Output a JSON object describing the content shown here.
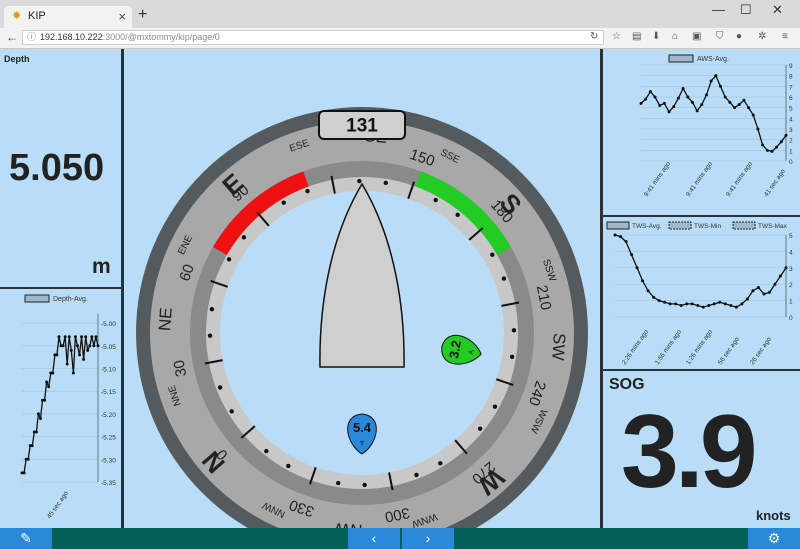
{
  "browser": {
    "tab_title": "KIP",
    "tab_icon": "sun-favicon-icon",
    "new_tab": "+",
    "url_host": "192.168.10.222",
    "url_rest": ":3000/@mxtommy/kip/page/0",
    "win_min": "—",
    "win_max": "☐",
    "win_close": "✕"
  },
  "depth": {
    "title": "Depth",
    "value": "5.050",
    "unit": "m"
  },
  "depth_chart": {
    "type": "line",
    "legend": "Depth-Avg.",
    "yticks": [
      "-5.00",
      "-5.05",
      "-5.10",
      "-5.15",
      "-5.20",
      "-5.25",
      "-5.30",
      "-5.35"
    ],
    "ylim": [
      -5.35,
      -4.98
    ],
    "xtick": "45 sec ago",
    "values": [
      -5.33,
      -5.33,
      -5.3,
      -5.3,
      -5.27,
      -5.27,
      -5.24,
      -5.24,
      -5.2,
      -5.21,
      -5.17,
      -5.17,
      -5.13,
      -5.14,
      -5.11,
      -5.11,
      -5.07,
      -5.07,
      -5.03,
      -5.05,
      -5.05,
      -5.03,
      -5.09,
      -5.03,
      -5.06,
      -5.11,
      -5.03,
      -5.05,
      -5.07,
      -5.03,
      -5.08,
      -5.03,
      -5.06,
      -5.05,
      -5.03,
      -5.05,
      -5.03,
      -5.05
    ]
  },
  "compass": {
    "heading": "131",
    "cardinals": [
      "N",
      "E",
      "S",
      "W"
    ],
    "intercardinals": [
      "NE",
      "SE",
      "SW",
      "NW"
    ],
    "minor": [
      "NNE",
      "ENE",
      "ESE",
      "SSE",
      "SSW",
      "WSW",
      "WNW",
      "NNW"
    ],
    "degree_labels": [
      "0",
      "30",
      "60",
      "90",
      "150",
      "180",
      "210",
      "240",
      "270",
      "300",
      "330"
    ],
    "true_wind": {
      "speed": "5.4",
      "marker": "T",
      "angle_deg": 180,
      "color": "#2a88d8"
    },
    "apparent_wind": {
      "speed": "3.2",
      "marker": "A",
      "angle_deg": 100,
      "color": "#22cc22"
    },
    "port_zone_color": "#ee1111",
    "starboard_zone_color": "#22cc22"
  },
  "aws_chart": {
    "type": "line",
    "legend": "AWS-Avg.",
    "yticks": [
      "9",
      "8",
      "7",
      "6",
      "5",
      "4",
      "3",
      "2",
      "1",
      "0"
    ],
    "ylim": [
      0,
      9
    ],
    "xticks": [
      "9:41 mins ago",
      "9:41 mins ago",
      "9:41 mins ago",
      "41 sec ago"
    ],
    "values": [
      5.4,
      5.8,
      6.5,
      6.0,
      5.2,
      5.4,
      4.6,
      5.1,
      5.9,
      6.8,
      6.0,
      5.5,
      4.7,
      5.3,
      6.2,
      7.5,
      8.0,
      7.0,
      6.0,
      5.5,
      5.0,
      5.3,
      5.7,
      5.0,
      4.3,
      3.0,
      1.5,
      1.0,
      0.9,
      1.3,
      1.8,
      2.4
    ]
  },
  "tws_chart": {
    "type": "line",
    "legend": [
      "TWS-Avg.",
      "TWS-Min",
      "TWS-Max"
    ],
    "yticks": [
      "5",
      "4",
      "3",
      "2",
      "1",
      "0"
    ],
    "ylim": [
      0,
      5
    ],
    "xticks": [
      "2:26 mins ago",
      "1:56 mins ago",
      "1:26 mins ago",
      "56 sec ago",
      "26 sec ago"
    ],
    "values": [
      5.0,
      4.9,
      4.6,
      3.8,
      3.0,
      2.2,
      1.6,
      1.2,
      1.0,
      0.9,
      0.8,
      0.8,
      0.7,
      0.8,
      0.8,
      0.7,
      0.6,
      0.7,
      0.8,
      0.9,
      0.8,
      0.7,
      0.6,
      0.8,
      1.1,
      1.6,
      1.8,
      1.4,
      1.5,
      2.0,
      2.5,
      3.0
    ]
  },
  "sog": {
    "title": "SOG",
    "value": "3.9",
    "unit": "knots"
  },
  "bottom": {
    "prev": "‹",
    "next": "›"
  },
  "colors": {
    "pane": "#b9ddf7",
    "divider": "#2a3138",
    "bar": "#03605a",
    "button": "#2a88d8"
  }
}
